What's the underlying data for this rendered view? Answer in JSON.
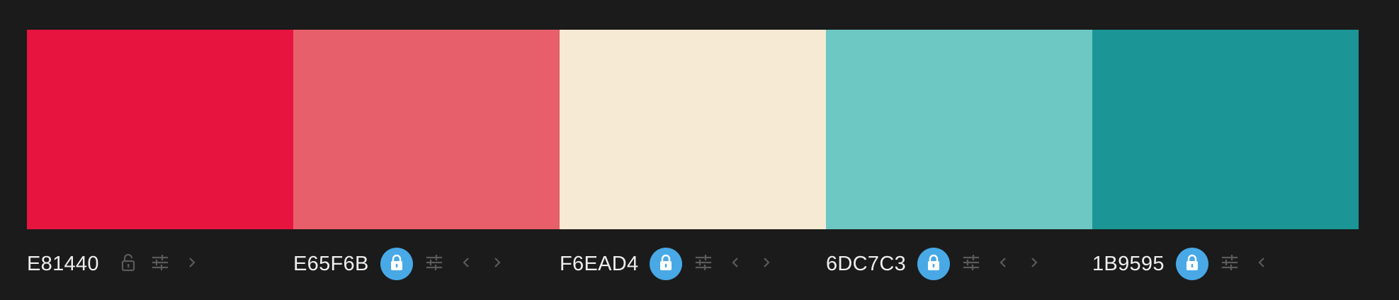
{
  "palette": {
    "colors": [
      {
        "hex": "E81440",
        "color": "#E81440",
        "locked": false,
        "has_left_arrow": false,
        "has_right_arrow": true
      },
      {
        "hex": "E65F6B",
        "color": "#E65F6B",
        "locked": true,
        "has_left_arrow": true,
        "has_right_arrow": true
      },
      {
        "hex": "F6EAD4",
        "color": "#F6EAD4",
        "locked": true,
        "has_left_arrow": true,
        "has_right_arrow": true
      },
      {
        "hex": "6DC7C3",
        "color": "#6DC7C3",
        "locked": true,
        "has_left_arrow": true,
        "has_right_arrow": true
      },
      {
        "hex": "1B9595",
        "color": "#1B9595",
        "locked": true,
        "has_left_arrow": true,
        "has_right_arrow": false
      }
    ]
  },
  "theme": {
    "background": "#1B1B1B",
    "lock_active_color": "#48A9E6",
    "icon_muted_color": "#5A5A5A"
  },
  "icons": {
    "lock": "lock-icon",
    "adjust": "sliders-icon",
    "left": "chevron-left-icon",
    "right": "chevron-right-icon"
  }
}
